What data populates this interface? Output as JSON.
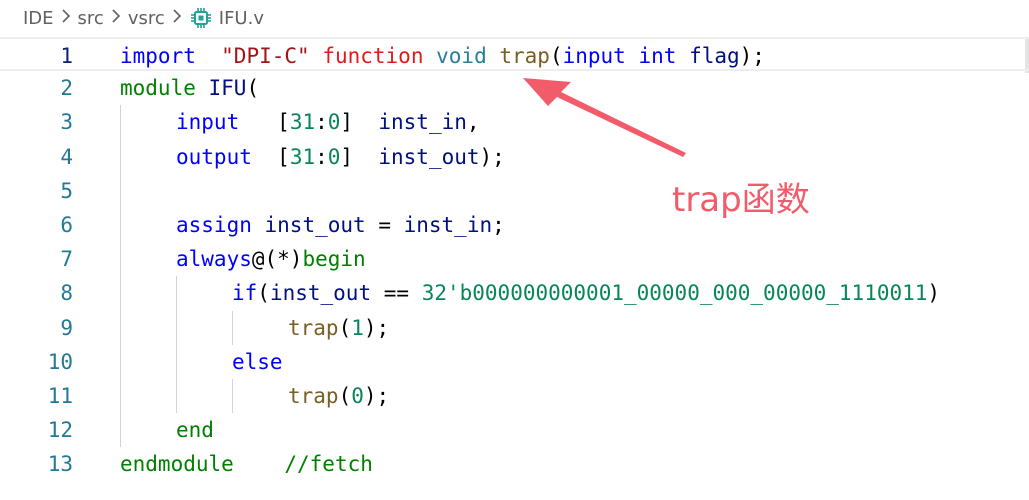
{
  "breadcrumb": {
    "items": [
      "IDE",
      "src",
      "vsrc",
      "IFU.v"
    ]
  },
  "editor": {
    "lines": [
      {
        "n": "1",
        "tokens": [
          [
            "kw",
            "import"
          ],
          [
            "",
            "  "
          ],
          [
            "str",
            "\"DPI-C\""
          ],
          [
            "",
            ""
          ],
          [
            "",
            " "
          ],
          [
            "red",
            "function"
          ],
          [
            "",
            " "
          ],
          [
            "teal",
            "void"
          ],
          [
            "",
            " "
          ],
          [
            "fn",
            "trap"
          ],
          [
            "",
            "("
          ],
          [
            "kw",
            "input"
          ],
          [
            "",
            " "
          ],
          [
            "kw",
            "int"
          ],
          [
            "",
            " "
          ],
          [
            "id",
            "flag"
          ],
          [
            "",
            ");"
          ]
        ]
      },
      {
        "n": "2",
        "tokens": [
          [
            "cmt",
            "module"
          ],
          [
            "",
            " "
          ],
          [
            "id",
            "IFU"
          ],
          [
            "",
            "("
          ]
        ]
      },
      {
        "n": "3",
        "tokens": [
          [
            "",
            ""
          ],
          [
            "kw",
            "input"
          ],
          [
            "",
            "   "
          ],
          [
            "",
            "["
          ],
          [
            "num",
            "31"
          ],
          [
            "",
            ":"
          ],
          [
            "num",
            "0"
          ],
          [
            "",
            "]"
          ],
          [
            "",
            "  "
          ],
          [
            "id",
            "inst_in"
          ],
          [
            "",
            ","
          ]
        ]
      },
      {
        "n": "4",
        "tokens": [
          [
            "kw",
            "output"
          ],
          [
            "",
            "  "
          ],
          [
            "",
            "["
          ],
          [
            "num",
            "31"
          ],
          [
            "",
            ":"
          ],
          [
            "num",
            "0"
          ],
          [
            "",
            "]"
          ],
          [
            "",
            "  "
          ],
          [
            "id",
            "inst_out"
          ],
          [
            "",
            ");"
          ]
        ]
      },
      {
        "n": "5",
        "tokens": []
      },
      {
        "n": "6",
        "tokens": [
          [
            "kw",
            "assign"
          ],
          [
            "",
            " "
          ],
          [
            "id",
            "inst_out"
          ],
          [
            "",
            " = "
          ],
          [
            "id",
            "inst_in"
          ],
          [
            "",
            ";"
          ]
        ]
      },
      {
        "n": "7",
        "tokens": [
          [
            "kw",
            "always"
          ],
          [
            "",
            "@(*)"
          ],
          [
            "cmt",
            "begin"
          ]
        ]
      },
      {
        "n": "8",
        "tokens": [
          [
            "kw",
            "if"
          ],
          [
            "",
            "("
          ],
          [
            "id",
            "inst_out"
          ],
          [
            "",
            " == "
          ],
          [
            "num",
            "32'b000000000001_00000_000_00000_1110011"
          ],
          [
            "",
            ")"
          ]
        ]
      },
      {
        "n": "9",
        "tokens": [
          [
            "fn",
            "trap"
          ],
          [
            "",
            "("
          ],
          [
            "num",
            "1"
          ],
          [
            "",
            ");"
          ]
        ]
      },
      {
        "n": "10",
        "tokens": [
          [
            "kw",
            "else"
          ]
        ]
      },
      {
        "n": "11",
        "tokens": [
          [
            "fn",
            "trap"
          ],
          [
            "",
            "("
          ],
          [
            "num",
            "0"
          ],
          [
            "",
            ");"
          ]
        ]
      },
      {
        "n": "12",
        "tokens": [
          [
            "cmt",
            "end"
          ]
        ]
      },
      {
        "n": "13",
        "tokens": [
          [
            "cmt",
            "endmodule"
          ],
          [
            "",
            "    "
          ],
          [
            "cmt",
            "//fetch"
          ]
        ]
      }
    ]
  },
  "annotation": {
    "text": "trap函数",
    "color": "#f25c6a"
  },
  "icons": {
    "file_icon": "chip-icon",
    "separator_icon": "chevron-right-icon"
  }
}
